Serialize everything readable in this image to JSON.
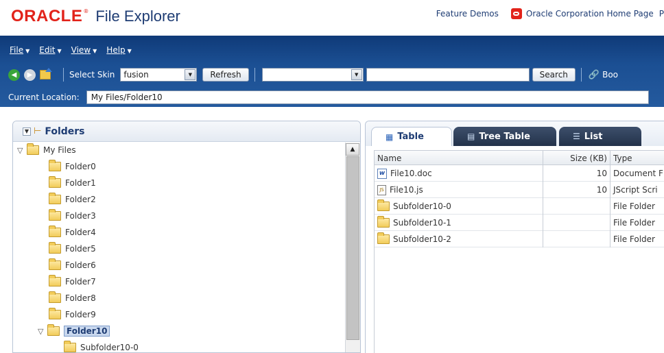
{
  "branding": {
    "logo_text": "ORACLE",
    "logo_mark": "®",
    "app_title": "File Explorer"
  },
  "top_links": {
    "feature_demos": "Feature Demos",
    "home_page": "Oracle Corporation Home Page",
    "home_page_icon": "oracle-o-icon",
    "overflow": "P"
  },
  "menu": {
    "file": "File",
    "edit": "Edit",
    "view": "View",
    "help": "Help"
  },
  "toolbar": {
    "back_icon": "back-arrow-icon",
    "forward_icon": "forward-arrow-icon",
    "up_icon": "folder-up-icon",
    "select_skin_label": "Select Skin",
    "skin_value": "fusion",
    "refresh_label": "Refresh",
    "search_scope_value": "",
    "search_input_value": "",
    "search_label": "Search",
    "bookmark_label": "Boo"
  },
  "location": {
    "label": "Current Location:",
    "value": "My Files/Folder10"
  },
  "left_panel": {
    "title": "Folders",
    "tree": [
      {
        "label": "My Files",
        "level": 0,
        "expanded": true,
        "selected": false
      },
      {
        "label": "Folder0",
        "level": 1,
        "expanded": false,
        "selected": false
      },
      {
        "label": "Folder1",
        "level": 1,
        "expanded": false,
        "selected": false
      },
      {
        "label": "Folder2",
        "level": 1,
        "expanded": false,
        "selected": false
      },
      {
        "label": "Folder3",
        "level": 1,
        "expanded": false,
        "selected": false
      },
      {
        "label": "Folder4",
        "level": 1,
        "expanded": false,
        "selected": false
      },
      {
        "label": "Folder5",
        "level": 1,
        "expanded": false,
        "selected": false
      },
      {
        "label": "Folder6",
        "level": 1,
        "expanded": false,
        "selected": false
      },
      {
        "label": "Folder7",
        "level": 1,
        "expanded": false,
        "selected": false
      },
      {
        "label": "Folder8",
        "level": 1,
        "expanded": false,
        "selected": false
      },
      {
        "label": "Folder9",
        "level": 1,
        "expanded": false,
        "selected": false
      },
      {
        "label": "Folder10",
        "level": 1,
        "expanded": true,
        "selected": true
      },
      {
        "label": "Subfolder10-0",
        "level": 2,
        "expanded": false,
        "selected": false
      }
    ]
  },
  "right_panel": {
    "tabs": [
      {
        "label": "Table",
        "icon": "table-icon",
        "active": true
      },
      {
        "label": "Tree Table",
        "icon": "tree-table-icon",
        "active": false
      },
      {
        "label": "List",
        "icon": "list-icon",
        "active": false
      }
    ],
    "columns": {
      "name": "Name",
      "size": "Size (KB)",
      "type": "Type"
    },
    "rows": [
      {
        "name": "File10.doc",
        "size": "10",
        "type": "Document F",
        "icon": "word-doc-icon"
      },
      {
        "name": "File10.js",
        "size": "10",
        "type": "JScript Scri",
        "icon": "script-file-icon"
      },
      {
        "name": "Subfolder10-0",
        "size": "",
        "type": "File Folder",
        "icon": "folder-icon"
      },
      {
        "name": "Subfolder10-1",
        "size": "",
        "type": "File Folder",
        "icon": "folder-icon"
      },
      {
        "name": "Subfolder10-2",
        "size": "",
        "type": "File Folder",
        "icon": "folder-icon"
      }
    ]
  },
  "colors": {
    "brand_red": "#e2231a",
    "chrome_blue": "#1b4f93",
    "title_navy": "#1e3c73",
    "folder_yellow": "#f2cc5a"
  }
}
